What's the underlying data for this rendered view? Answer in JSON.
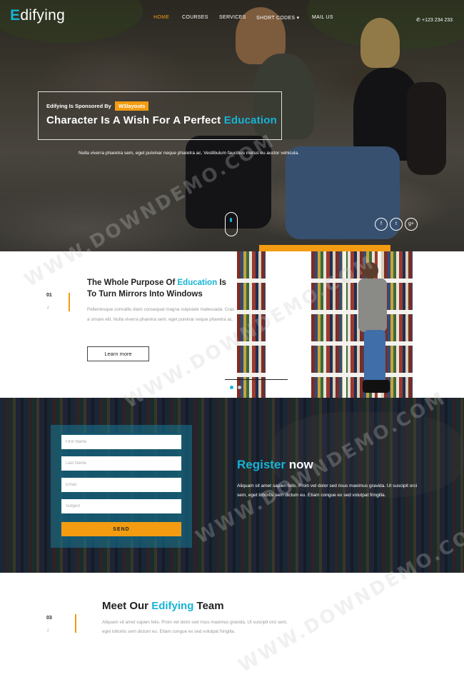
{
  "brand": {
    "first_letter": "E",
    "rest": "difying"
  },
  "nav": {
    "items": [
      {
        "label": "HOME",
        "active": true
      },
      {
        "label": "COURSES",
        "active": false
      },
      {
        "label": "SERVICES",
        "active": false
      },
      {
        "label": "SHORT CODES",
        "active": false,
        "dropdown": true
      },
      {
        "label": "MAIL US",
        "active": false
      }
    ],
    "dropdown_caret": "▾",
    "phone": "+123 234 233",
    "phone_icon": "phone-icon"
  },
  "hero": {
    "sponsor_text": "Edifying Is Sponsored By",
    "sponsor_badge": "W3layouts",
    "title_main": "Character Is A Wish For A Perfect",
    "title_accent": "Education",
    "subtitle": "Nulla viverra pharetra sem, eget pulvinar neque pharetra ac. Vestibulum faucibus metus eu auctor vehicula.",
    "social": [
      {
        "icon": "facebook-icon",
        "glyph": "f"
      },
      {
        "icon": "twitter-icon",
        "glyph": "t"
      },
      {
        "icon": "google-plus-icon",
        "glyph": "g+"
      }
    ]
  },
  "about": {
    "number": "01",
    "title_pre": "The Whole Purpose Of",
    "title_accent": "Education",
    "title_post": "Is To Turn Mirrors Into Windows",
    "text": "Pellentesque convallis diam consequat magna vulputate malesuada. Cras a ornare elit. Nulla viverra pharetra sem, eget pulvinar neque pharetra ac.",
    "button": "Learn more",
    "arrow_glyph": "↓"
  },
  "register": {
    "fields": [
      "First Name",
      "Last Name",
      "Email",
      "Subject"
    ],
    "send": "SEND",
    "title_accent": "Register",
    "title_rest": "now",
    "text": "Aliquam sit amet sapien felis. Proin vel dolor sed risus maximus gravida. Ut suscipit orci sem, eget lobortis sem dictum eu. Etiam congue ex sed volutpat fringilla."
  },
  "team": {
    "number": "03",
    "title_pre": "Meet Our",
    "title_accent": "Edifying",
    "title_post": "Team",
    "text": "Aliquam sit amet sapien felis. Proin vel dolor sed risus maximus gravida. Ut suscipit orci sem, eget lobortis sem dictum eu. Etiam congue ex sed volutpat fringilla.",
    "arrow_glyph": "↓"
  },
  "watermark": "WWW.DOWNDEMO.COM",
  "colors": {
    "accent_blue": "#17b3d6",
    "accent_orange": "#f39c12"
  }
}
